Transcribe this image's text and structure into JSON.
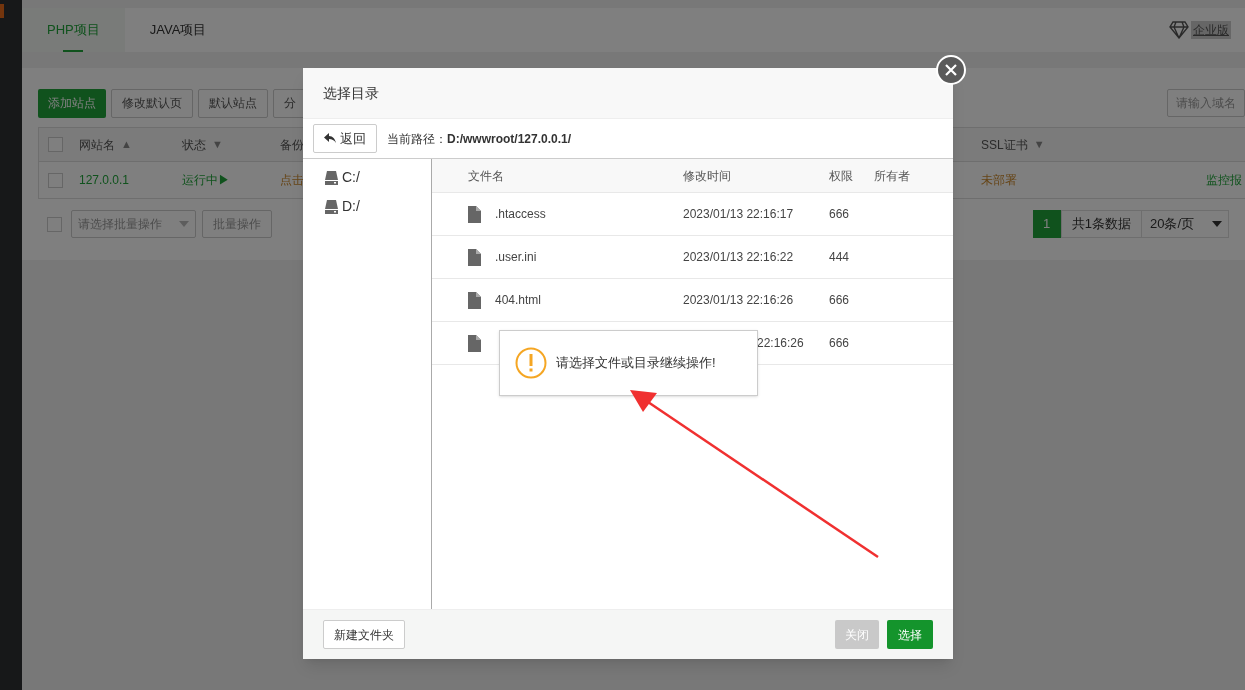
{
  "tabs": [
    {
      "label": "PHP项目",
      "selected": true
    },
    {
      "label": "JAVA项目",
      "selected": false
    }
  ],
  "edition_badge": "企业版",
  "toolbar": {
    "buttons": [
      {
        "label": "添加站点",
        "primary": true
      },
      {
        "label": "修改默认页",
        "primary": false
      },
      {
        "label": "默认站点",
        "primary": false
      },
      {
        "label": "分",
        "primary": false
      }
    ],
    "search_placeholder": "请输入域名"
  },
  "sites_table": {
    "select_all_checked": false,
    "columns": [
      {
        "label": "网站名",
        "sort_arrow": "▲"
      },
      {
        "label": "状态",
        "sort_arrow": "▼"
      },
      {
        "label": "备份"
      },
      {
        "label": "SSL证书",
        "sort_arrow": "▼"
      }
    ],
    "rows": [
      {
        "checked": false,
        "name": "127.0.0.1",
        "status": "运行中▶",
        "backup": "点击",
        "ssl": "未部署",
        "action": "监控报"
      }
    ]
  },
  "batch": {
    "checked": false,
    "placeholder": "请选择批量操作",
    "button": "批量操作"
  },
  "pagination": {
    "current": "1",
    "total": "共1条数据",
    "page_size": "20条/页"
  },
  "dialog": {
    "title": "选择目录",
    "back": "返回",
    "path_label": "当前路径：",
    "path": "D:/wwwroot/127.0.0.1/",
    "drives": [
      {
        "label": "C:/"
      },
      {
        "label": "D:/"
      }
    ],
    "columns": [
      "文件名",
      "修改时间",
      "权限",
      "所有者"
    ],
    "files": [
      {
        "name": ".htaccess",
        "time": "2023/01/13 22:16:17",
        "perm": "666",
        "covered": false
      },
      {
        "name": ".user.ini",
        "time": "2023/01/13 22:16:22",
        "perm": "444",
        "covered": false
      },
      {
        "name": "404.html",
        "time": "2023/01/13 22:16:26",
        "perm": "666",
        "covered": false
      },
      {
        "time": "22:16:26",
        "perm": "666",
        "covered": true
      }
    ],
    "new_folder": "新建文件夹",
    "close": {
      "label": "关闭",
      "disabled": true
    },
    "select": "选择"
  },
  "toast": {
    "message": "请选择文件或目录继续操作!"
  }
}
